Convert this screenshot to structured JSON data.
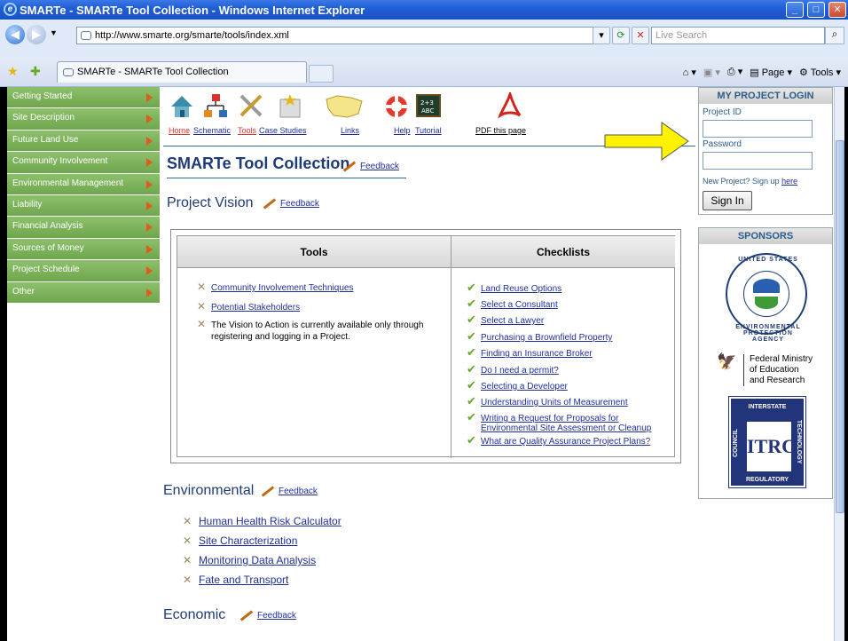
{
  "window": {
    "title": "SMARTe - SMARTe Tool Collection - Windows Internet Explorer",
    "url": "http://www.smarte.org/smarte/tools/index.xml",
    "search_placeholder": "Live Search",
    "tab_title": "SMARTe - SMARTe Tool Collection",
    "cmd_page": "Page",
    "cmd_tools": "Tools"
  },
  "leftnav": {
    "items": [
      {
        "label": "Getting Started"
      },
      {
        "label": "Site Description"
      },
      {
        "label": "Future Land Use"
      },
      {
        "label": "Community Involvement"
      },
      {
        "label": "Environmental Management"
      },
      {
        "label": "Liability"
      },
      {
        "label": "Financial Analysis"
      },
      {
        "label": "Sources of Money"
      },
      {
        "label": "Project Schedule"
      },
      {
        "label": "Other"
      }
    ]
  },
  "toolbar": {
    "home": "Home",
    "schematic": "Schematic",
    "tools": "Tools",
    "case_studies": "Case Studies",
    "links": "Links",
    "help": "Help",
    "tutorial": "Tutorial",
    "pdf": "PDF this page"
  },
  "main": {
    "page_title": "SMARTe Tool Collection",
    "feedback": "Feedback",
    "project_vision": "Project Vision",
    "environmental": "Environmental",
    "economic": "Economic",
    "table": {
      "tools_header": "Tools",
      "checklists_header": "Checklists",
      "tools": [
        "Community Involvement Techniques",
        "Potential Stakeholders"
      ],
      "vision_note": "The Vision to Action is currently available only through registering and logging in a Project.",
      "checklists": [
        "Land Reuse Options",
        "Select a Consultant",
        "Select a Lawyer",
        "Purchasing a Brownfield Property",
        "Finding an Insurance Broker",
        "Do I need a permit?",
        "Selecting a Developer",
        "Understanding Units of Measurement",
        "Writing a Request for Proposals for Environmental Site Assessment or Cleanup",
        "What are Quality Assurance Project Plans?"
      ]
    },
    "environmental_items": [
      "Human Health Risk Calculator",
      "Site Characterization",
      "Monitoring Data Analysis",
      "Fate and Transport"
    ]
  },
  "login": {
    "header": "MY PROJECT LOGIN",
    "project_id_label": "Project ID",
    "password_label": "Password",
    "signup_text": "New Project? Sign up",
    "signup_link": "here",
    "signin_button": "Sign In"
  },
  "sponsors": {
    "header": "SPONSORS",
    "epa_top": "UNITED STATES",
    "epa_bottom": "ENVIRONMENTAL PROTECTION AGENCY",
    "bmbf_line1": "Federal Ministry",
    "bmbf_line2": "of Education",
    "bmbf_line3": "and Research",
    "itrc_logo": "ITRC",
    "itrc_top": "INTERSTATE",
    "itrc_bottom": "REGULATORY",
    "itrc_left": "COUNCIL",
    "itrc_right": "TECHNOLOGY"
  }
}
